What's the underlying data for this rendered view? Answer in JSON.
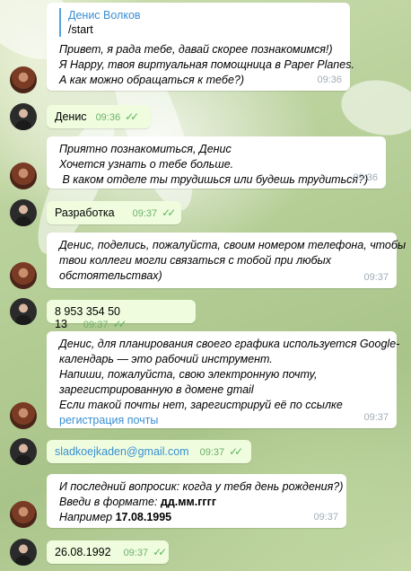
{
  "messages": [
    {
      "reply": {
        "name": "Денис Волков",
        "text": "/start"
      },
      "lines": [
        "Привет, я рада тебе, давай скорее познакомимся!)",
        "Я Happy, твоя виртуальная помощница в Paper Planes.",
        "А как можно обращаться к тебе?)"
      ],
      "time": "09:36"
    },
    {
      "text": "Денис",
      "time": "09:36"
    },
    {
      "lines": [
        "Приятно познакомиться, Денис",
        "Хочется узнать о тебе больше.",
        " В каком отделе ты трудишься или будешь трудиться?)"
      ],
      "time": "09:36"
    },
    {
      "text": "Разработка",
      "time": "09:37"
    },
    {
      "lines": [
        "Денис, поделись, пожалуйста, своим номером телефона, чтобы",
        "твои коллеги могли связаться с тобой при любых",
        "обстоятельствах)"
      ],
      "time": "09:37"
    },
    {
      "text": "8 953 354 50 13",
      "time": "09:37"
    },
    {
      "lines": [
        "Денис, для планирования своего графика используется Google-",
        "календарь — это рабочий инструмент.",
        "Напиши, пожалуйста, свою электронную почту,",
        "зарегистрированную в домене gmail",
        "Если такой почты нет, зарегистрируй её по ссылке"
      ],
      "link": "регистрация почты",
      "time": "09:37"
    },
    {
      "text": "sladkoejkaden@gmail.com",
      "time": "09:37"
    },
    {
      "line1": "И последний вопросик: когда у тебя день рождения?)",
      "line2_prefix": "Введи в формате: ",
      "line2_bold": "дд.мм.гггг",
      "line3_prefix": "Например ",
      "line3_bold": "17.08.1995",
      "time": "09:37"
    },
    {
      "text": "26.08.1992",
      "time": "09:37"
    }
  ]
}
